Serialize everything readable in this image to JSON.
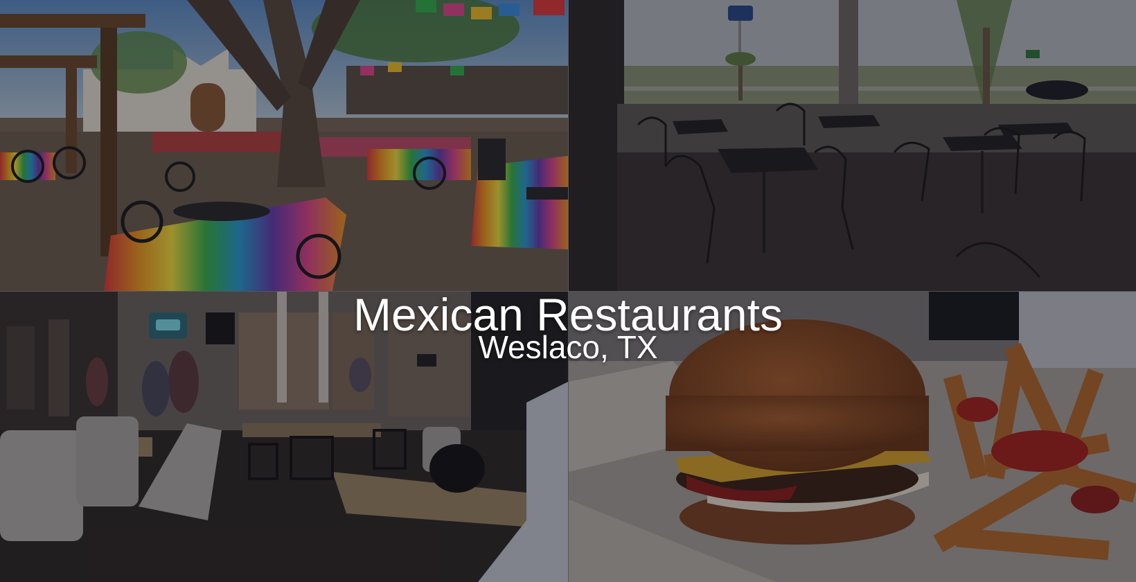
{
  "hero": {
    "title": "Mexican Restaurants",
    "subtitle": "Weslaco, TX"
  },
  "photos": [
    {
      "name": "outdoor-patio-photo",
      "subject": "outdoor patio with striped tablecloths and papel picado"
    },
    {
      "name": "covered-terrace-photo",
      "subject": "covered terrace with wrought-iron tables and chairs"
    },
    {
      "name": "dining-room-photo",
      "subject": "indoor dining room with tables and chairs"
    },
    {
      "name": "burger-fries-photo",
      "subject": "cheeseburger with fries and ketchup"
    }
  ],
  "colors": {
    "title_text": "#ffffff",
    "overlay": "rgba(10,10,20,0.38)"
  }
}
